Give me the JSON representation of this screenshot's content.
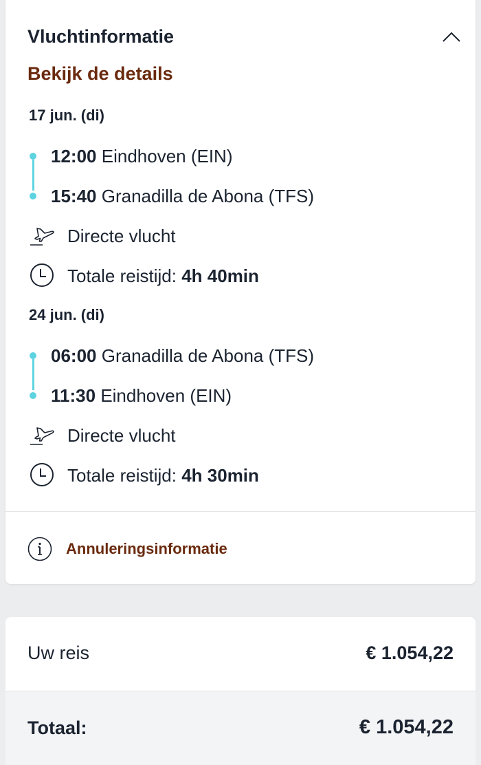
{
  "flight_info": {
    "title": "Vluchtinformatie",
    "details_link": "Bekijk de details",
    "legs": [
      {
        "date": "17 jun. (di)",
        "departure": {
          "time": "12:00",
          "place": "Eindhoven (EIN)"
        },
        "arrival": {
          "time": "15:40",
          "place": "Granadilla de Abona (TFS)"
        },
        "flight_type": "Directe vlucht",
        "duration_label": "Totale reistijd:",
        "duration_value": "4h 40min"
      },
      {
        "date": "24 jun. (di)",
        "departure": {
          "time": "06:00",
          "place": "Granadilla de Abona (TFS)"
        },
        "arrival": {
          "time": "11:30",
          "place": "Eindhoven (EIN)"
        },
        "flight_type": "Directe vlucht",
        "duration_label": "Totale reistijd:",
        "duration_value": "4h 30min"
      }
    ],
    "cancellation_link": "Annuleringsinformatie"
  },
  "price_summary": {
    "trip_label": "Uw reis",
    "trip_value": "€ 1.054,22",
    "total_label": "Totaal:",
    "total_value": "€ 1.054,22"
  },
  "colors": {
    "accent_link": "#6a2a0e",
    "timeline": "#5ed3e0",
    "text": "#1b2330",
    "background": "#ecedef"
  },
  "icons": [
    "chevron-up-icon",
    "plane-icon",
    "clock-icon",
    "info-icon"
  ]
}
